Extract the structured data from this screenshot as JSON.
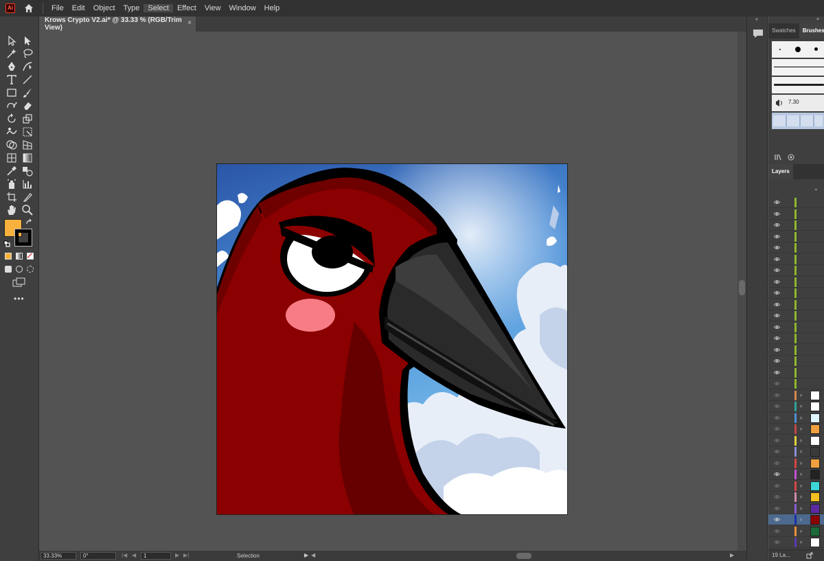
{
  "app": {
    "logo_text": "Ai"
  },
  "menu": {
    "items": [
      "File",
      "Edit",
      "Object",
      "Type",
      "Select",
      "Effect",
      "View",
      "Window",
      "Help"
    ]
  },
  "document": {
    "tab_title": "Krows Crypto V2.ai* @ 33.33 % (RGB/Trim View)",
    "close_glyph": "×"
  },
  "colors": {
    "fill": "#f7b13c",
    "stroke": "#000000",
    "accent_selection": "#4d6a8e"
  },
  "status": {
    "zoom": "33.33%",
    "rotation": "0°",
    "artboard": "1",
    "tool": "Selection"
  },
  "panels": {
    "top_tabs": [
      "Swatches",
      "Brushes"
    ],
    "brush_size": "7.30",
    "layers_tab": "Layers",
    "layers_count": "19 La..."
  },
  "layers": {
    "colors": [
      "#8fb82e",
      "#8fb82e",
      "#8fb82e",
      "#8fb82e",
      "#8fb82e",
      "#8fb82e",
      "#8fb82e",
      "#8fb82e",
      "#8fb82e",
      "#8fb82e",
      "#8fb82e",
      "#8fb82e",
      "#8fb82e",
      "#8fb82e",
      "#8fb82e",
      "#8fb82e",
      "#8fb82e",
      "#d9884a",
      "#2ea39a",
      "#4d8fd6",
      "#c44545",
      "#e0d341",
      "#8a8fd6",
      "#d64545",
      "#c44fd6",
      "#d64545",
      "#d08aa8",
      "#8a5cd6",
      "#1c2fa8",
      "#e8913c",
      "#5a3ab0",
      "#8a5530",
      "#4d8fd6"
    ],
    "has_children_from": 17,
    "visible_rows": [
      0,
      1,
      2,
      3,
      4,
      5,
      6,
      7,
      8,
      9,
      10,
      11,
      12,
      13,
      14,
      15,
      24,
      28,
      31
    ],
    "selected_row": 28
  }
}
